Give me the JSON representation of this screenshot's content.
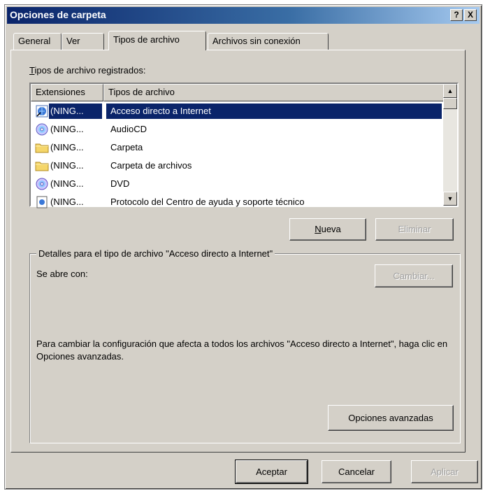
{
  "window": {
    "title": "Opciones de carpeta",
    "help_label": "?",
    "close_label": "X"
  },
  "tabs": [
    {
      "label": "General",
      "active": false
    },
    {
      "label": "Ver",
      "active": false
    },
    {
      "label": "Tipos de archivo",
      "active": true
    },
    {
      "label": "Archivos sin conexión",
      "active": false
    }
  ],
  "registered": {
    "label_first": "T",
    "label_rest": "ipos de archivo registrados:",
    "columns": [
      "Extensiones",
      "Tipos de archivo"
    ],
    "rows": [
      {
        "ext": "(NING...",
        "type": "Acceso directo a Internet",
        "icon": "internet-shortcut-icon",
        "selected": true
      },
      {
        "ext": "(NING...",
        "type": "AudioCD",
        "icon": "cd-icon",
        "selected": false
      },
      {
        "ext": "(NING...",
        "type": "Carpeta",
        "icon": "folder-icon",
        "selected": false
      },
      {
        "ext": "(NING...",
        "type": "Carpeta de archivos",
        "icon": "folder-icon",
        "selected": false
      },
      {
        "ext": "(NING...",
        "type": "DVD",
        "icon": "dvd-icon",
        "selected": false
      },
      {
        "ext": "(NING...",
        "type": "Protocolo del Centro de ayuda y soporte técnico",
        "icon": "help-protocol-icon",
        "selected": false
      }
    ]
  },
  "buttons": {
    "nueva_first": "N",
    "nueva_rest": "ueva",
    "eliminar": "Eliminar",
    "cambiar": "Cambiar...",
    "opciones_avanzadas": "Opciones avanzadas",
    "aceptar": "Aceptar",
    "cancelar": "Cancelar",
    "aplicar": "Aplicar"
  },
  "details": {
    "legend": "Detalles para el tipo de archivo \"Acceso directo a Internet\"",
    "opens_with": "Se abre con:",
    "info": "Para cambiar la configuración que afecta a todos los archivos \"Acceso directo a Internet\", haga clic en Opciones avanzadas."
  },
  "colors": {
    "face": "#d4d0c8",
    "selection": "#0a246a",
    "title_start": "#0a246a",
    "title_end": "#a6caf0"
  }
}
